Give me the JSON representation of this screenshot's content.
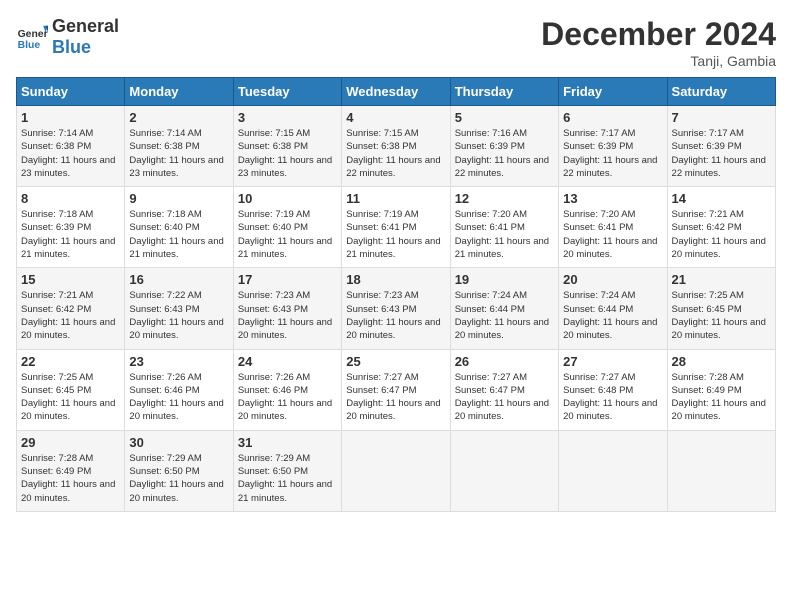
{
  "header": {
    "logo_general": "General",
    "logo_blue": "Blue",
    "title": "December 2024",
    "subtitle": "Tanji, Gambia"
  },
  "days_of_week": [
    "Sunday",
    "Monday",
    "Tuesday",
    "Wednesday",
    "Thursday",
    "Friday",
    "Saturday"
  ],
  "weeks": [
    [
      {
        "day": "1",
        "info": "Sunrise: 7:14 AM\nSunset: 6:38 PM\nDaylight: 11 hours\nand 23 minutes."
      },
      {
        "day": "2",
        "info": "Sunrise: 7:14 AM\nSunset: 6:38 PM\nDaylight: 11 hours\nand 23 minutes."
      },
      {
        "day": "3",
        "info": "Sunrise: 7:15 AM\nSunset: 6:38 PM\nDaylight: 11 hours\nand 23 minutes."
      },
      {
        "day": "4",
        "info": "Sunrise: 7:15 AM\nSunset: 6:38 PM\nDaylight: 11 hours\nand 22 minutes."
      },
      {
        "day": "5",
        "info": "Sunrise: 7:16 AM\nSunset: 6:39 PM\nDaylight: 11 hours\nand 22 minutes."
      },
      {
        "day": "6",
        "info": "Sunrise: 7:17 AM\nSunset: 6:39 PM\nDaylight: 11 hours\nand 22 minutes."
      },
      {
        "day": "7",
        "info": "Sunrise: 7:17 AM\nSunset: 6:39 PM\nDaylight: 11 hours\nand 22 minutes."
      }
    ],
    [
      {
        "day": "8",
        "info": "Sunrise: 7:18 AM\nSunset: 6:39 PM\nDaylight: 11 hours\nand 21 minutes."
      },
      {
        "day": "9",
        "info": "Sunrise: 7:18 AM\nSunset: 6:40 PM\nDaylight: 11 hours\nand 21 minutes."
      },
      {
        "day": "10",
        "info": "Sunrise: 7:19 AM\nSunset: 6:40 PM\nDaylight: 11 hours\nand 21 minutes."
      },
      {
        "day": "11",
        "info": "Sunrise: 7:19 AM\nSunset: 6:41 PM\nDaylight: 11 hours\nand 21 minutes."
      },
      {
        "day": "12",
        "info": "Sunrise: 7:20 AM\nSunset: 6:41 PM\nDaylight: 11 hours\nand 21 minutes."
      },
      {
        "day": "13",
        "info": "Sunrise: 7:20 AM\nSunset: 6:41 PM\nDaylight: 11 hours\nand 20 minutes."
      },
      {
        "day": "14",
        "info": "Sunrise: 7:21 AM\nSunset: 6:42 PM\nDaylight: 11 hours\nand 20 minutes."
      }
    ],
    [
      {
        "day": "15",
        "info": "Sunrise: 7:21 AM\nSunset: 6:42 PM\nDaylight: 11 hours\nand 20 minutes."
      },
      {
        "day": "16",
        "info": "Sunrise: 7:22 AM\nSunset: 6:43 PM\nDaylight: 11 hours\nand 20 minutes."
      },
      {
        "day": "17",
        "info": "Sunrise: 7:23 AM\nSunset: 6:43 PM\nDaylight: 11 hours\nand 20 minutes."
      },
      {
        "day": "18",
        "info": "Sunrise: 7:23 AM\nSunset: 6:43 PM\nDaylight: 11 hours\nand 20 minutes."
      },
      {
        "day": "19",
        "info": "Sunrise: 7:24 AM\nSunset: 6:44 PM\nDaylight: 11 hours\nand 20 minutes."
      },
      {
        "day": "20",
        "info": "Sunrise: 7:24 AM\nSunset: 6:44 PM\nDaylight: 11 hours\nand 20 minutes."
      },
      {
        "day": "21",
        "info": "Sunrise: 7:25 AM\nSunset: 6:45 PM\nDaylight: 11 hours\nand 20 minutes."
      }
    ],
    [
      {
        "day": "22",
        "info": "Sunrise: 7:25 AM\nSunset: 6:45 PM\nDaylight: 11 hours\nand 20 minutes."
      },
      {
        "day": "23",
        "info": "Sunrise: 7:26 AM\nSunset: 6:46 PM\nDaylight: 11 hours\nand 20 minutes."
      },
      {
        "day": "24",
        "info": "Sunrise: 7:26 AM\nSunset: 6:46 PM\nDaylight: 11 hours\nand 20 minutes."
      },
      {
        "day": "25",
        "info": "Sunrise: 7:27 AM\nSunset: 6:47 PM\nDaylight: 11 hours\nand 20 minutes."
      },
      {
        "day": "26",
        "info": "Sunrise: 7:27 AM\nSunset: 6:47 PM\nDaylight: 11 hours\nand 20 minutes."
      },
      {
        "day": "27",
        "info": "Sunrise: 7:27 AM\nSunset: 6:48 PM\nDaylight: 11 hours\nand 20 minutes."
      },
      {
        "day": "28",
        "info": "Sunrise: 7:28 AM\nSunset: 6:49 PM\nDaylight: 11 hours\nand 20 minutes."
      }
    ],
    [
      {
        "day": "29",
        "info": "Sunrise: 7:28 AM\nSunset: 6:49 PM\nDaylight: 11 hours\nand 20 minutes."
      },
      {
        "day": "30",
        "info": "Sunrise: 7:29 AM\nSunset: 6:50 PM\nDaylight: 11 hours\nand 20 minutes."
      },
      {
        "day": "31",
        "info": "Sunrise: 7:29 AM\nSunset: 6:50 PM\nDaylight: 11 hours\nand 21 minutes."
      },
      {
        "day": "",
        "info": ""
      },
      {
        "day": "",
        "info": ""
      },
      {
        "day": "",
        "info": ""
      },
      {
        "day": "",
        "info": ""
      }
    ]
  ]
}
